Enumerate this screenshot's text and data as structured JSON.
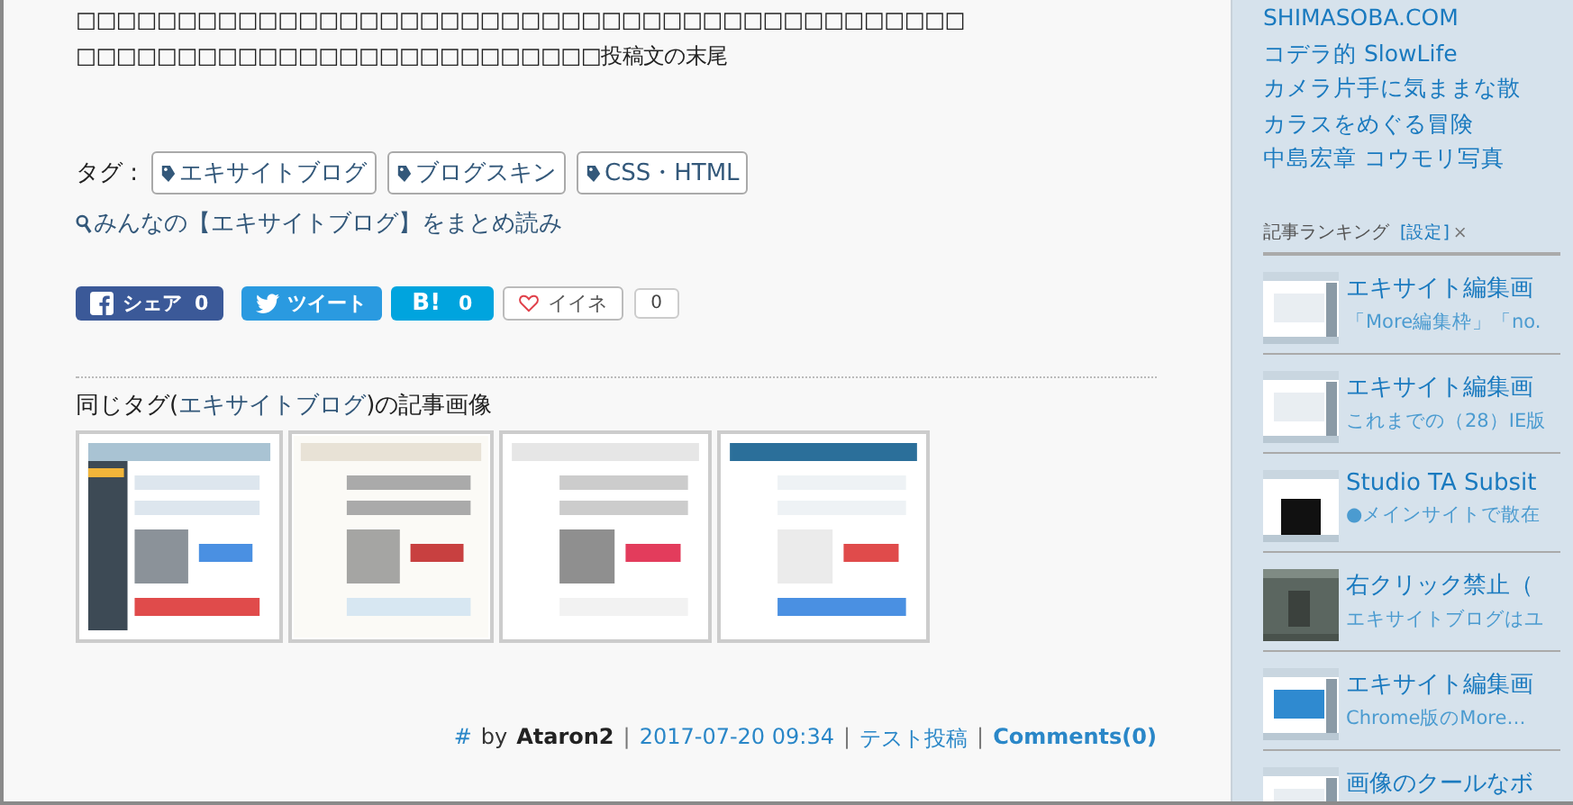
{
  "post": {
    "body_lines": [
      "□□□□□□□□□□□□□□□□□□□□□□□□□□□□□□□□□□□□□□□□□□□□",
      "□□□□□□□□□□□□□□□□□□□□□□□□□□投稿文の末尾"
    ],
    "tags_label": "タグ :",
    "tags": [
      "エキサイトブログ",
      "ブログスキン",
      "CSS・HTML"
    ],
    "tag_search_link": "みんなの【エキサイトブログ】をまとめ読み"
  },
  "share_buttons": [
    {
      "kind": "facebook",
      "label": "シェア",
      "count": "0"
    },
    {
      "kind": "twitter",
      "label": "ツイート"
    },
    {
      "kind": "hatena",
      "label": "B!",
      "count": "0"
    },
    {
      "kind": "like",
      "label": "イイネ",
      "count": "0"
    }
  ],
  "related": {
    "heading_prefix": "同じタグ(",
    "tag": "エキサイトブログ",
    "heading_suffix": ")の記事画像"
  },
  "footer": [
    {
      "kind": "link",
      "text": "#"
    },
    {
      "kind": "plain",
      "text": "by"
    },
    {
      "kind": "author",
      "text": "Ataron2"
    },
    {
      "kind": "sep",
      "text": "|"
    },
    {
      "kind": "link",
      "text": "2017-07-20 09:34"
    },
    {
      "kind": "sep",
      "text": "|"
    },
    {
      "kind": "link",
      "text": "テスト投稿"
    },
    {
      "kind": "sep",
      "text": "|"
    },
    {
      "kind": "boldlink",
      "text": "Comments(0)"
    }
  ],
  "sidebar": {
    "links": [
      "SHIMASOBA.COM",
      "コデラ的 SlowLife",
      "カメラ片手に気ままな散",
      "カラスをめぐる冒険",
      "中島宏章 コウモリ写真"
    ],
    "ranking": {
      "title": "記事ランキング",
      "settings": "[設定]",
      "close": "×",
      "items": [
        {
          "title": "エキサイト編集画",
          "excerpt": "「More編集枠」「no."
        },
        {
          "title": "エキサイト編集画",
          "excerpt": "これまでの（28）IE版"
        },
        {
          "title": "Studio TA Subsit",
          "excerpt": "●メインサイトで散在"
        },
        {
          "title": "右クリック禁止（",
          "excerpt": "エキサイトブログはユ"
        },
        {
          "title": "エキサイト編集画",
          "excerpt": "Chrome版のMore…"
        },
        {
          "title": "画像のクールなボ"
        }
      ]
    }
  }
}
